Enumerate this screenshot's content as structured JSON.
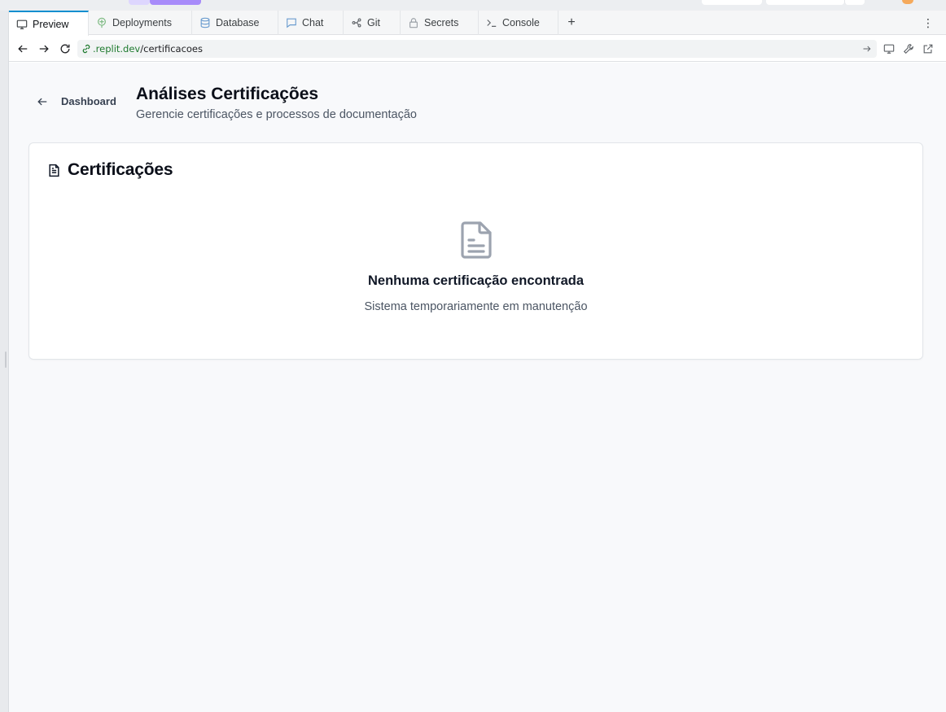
{
  "tabs": [
    {
      "label": "Preview",
      "icon": "monitor-icon",
      "active": true
    },
    {
      "label": "Deployments",
      "icon": "deployments-icon",
      "active": false
    },
    {
      "label": "Database",
      "icon": "database-icon",
      "active": false
    },
    {
      "label": "Chat",
      "icon": "chat-icon",
      "active": false
    },
    {
      "label": "Git",
      "icon": "git-icon",
      "active": false
    },
    {
      "label": "Secrets",
      "icon": "lock-icon",
      "active": false
    },
    {
      "label": "Console",
      "icon": "terminal-icon",
      "active": false
    }
  ],
  "tabbar": {
    "add_label": "+",
    "menu_label": "⋮"
  },
  "address": {
    "host": ".replit.dev",
    "path": "/certificacoes"
  },
  "page": {
    "back_label": "Dashboard",
    "title": "Análises Certificações",
    "subtitle": "Gerencie certificações e processos de documentação"
  },
  "card": {
    "title": "Certificações",
    "empty_title": "Nenhuma certificação encontrada",
    "empty_text": "Sistema temporariamente em manutenção"
  },
  "colors": {
    "accent_tab": "#0b8ecf",
    "url_host": "#1e7a2e",
    "page_bg": "#f8f9fb",
    "empty_icon": "#9ca3af"
  }
}
